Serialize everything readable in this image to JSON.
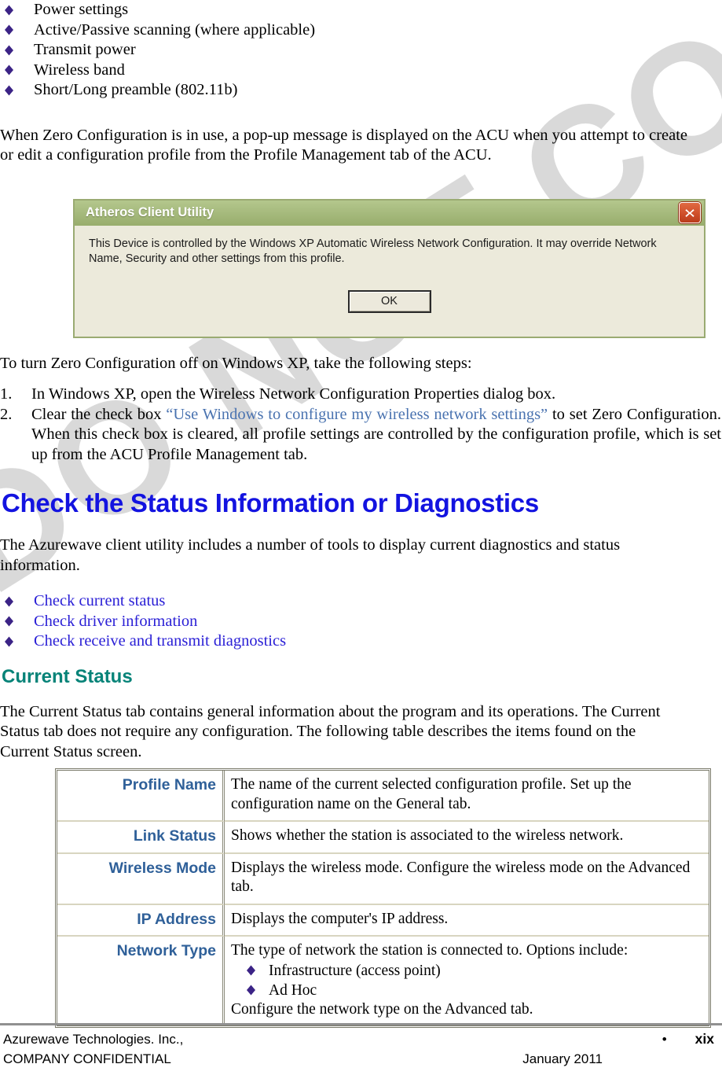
{
  "feature_bullets": [
    {
      "label": "Power settings"
    },
    {
      "label": "Active/Passive scanning (where applicable)"
    },
    {
      "label": "Transmit power"
    },
    {
      "label": "Wireless band"
    },
    {
      "label": "Short/Long preamble (802.11b)"
    }
  ],
  "intro_paragraph": "When Zero Configuration is in use, a pop-up message is displayed on the ACU when you attempt to create or edit a configuration profile from the Profile Management tab of the ACU.",
  "dialog": {
    "title": "Atheros Client Utility",
    "message": "This Device is controlled by the Windows XP Automatic Wireless Network Configuration. It may override Network Name, Security and other settings from this profile.",
    "ok_label": "OK",
    "close_label": "×",
    "titlebar_color": "#a7bb7e",
    "body_color": "#eceadb",
    "close_button_color": "#cf4f2b"
  },
  "steps_intro": "To turn Zero Configuration off on Windows XP, take the following steps:",
  "steps": [
    {
      "number": "1.",
      "text_parts": [
        {
          "text": "In Windows XP, open the Wireless Network Configuration Properties dialog box.",
          "style": "normal"
        }
      ]
    },
    {
      "number": "2.",
      "text_parts": [
        {
          "text": " Clear the check box ",
          "style": "normal"
        },
        {
          "text": "“Use Windows to configure my wireless network settings”",
          "style": "link"
        },
        {
          "text": " to set Zero Configuration.  When this check box is cleared, all profile settings are controlled by the configuration profile, which is set up from the ACU Profile Management tab.",
          "style": "normal"
        }
      ]
    }
  ],
  "main_heading": "Check the Status Information or Diagnostics",
  "main_heading_color": "#1313e0",
  "diagnostics_paragraph": "The Azurewave client utility includes a number of tools to display current diagnostics and status information.",
  "diagnostics_links": [
    {
      "label": "Check current status"
    },
    {
      "label": "Check driver information"
    },
    {
      "label": "Check receive and transmit diagnostics"
    }
  ],
  "sub_heading": "Current Status",
  "sub_heading_color": "#068378",
  "current_status_paragraph": "The Current Status tab contains general information about the program and its operations. The Current Status tab does not require any configuration. The following table describes the items found on the Current Status screen.",
  "status_table": {
    "label_color": "#2f6099",
    "rows": [
      {
        "label": "Profile Name",
        "description": "The name of the current selected configuration profile.  Set up the configuration name on the General tab.",
        "bullets": [],
        "description_after": ""
      },
      {
        "label": "Link Status",
        "description": "Shows whether the station is associated to the wireless network.",
        "bullets": [],
        "description_after": ""
      },
      {
        "label": "Wireless Mode",
        "description": "Displays the wireless mode.  Configure the wireless mode on the Advanced tab.",
        "bullets": [],
        "description_after": ""
      },
      {
        "label": "IP Address",
        "description": "Displays the computer's IP address.",
        "bullets": [],
        "description_after": ""
      },
      {
        "label": "Network Type",
        "description": "The type of network the station is connected to.  Options include:",
        "bullets": [
          {
            "label": "Infrastructure (access point)"
          },
          {
            "label": "Ad Hoc"
          }
        ],
        "description_after": "Configure the network type on the Advanced tab."
      }
    ]
  },
  "watermark": {
    "text": "DO NOT COPY",
    "color": "#d8d8d8"
  },
  "footer": {
    "company": "Azurewave Technologies. Inc.,",
    "confidential": "COMPANY CONFIDENTIAL",
    "separator_dot": "•",
    "page_number": "xix",
    "date": "January 2011"
  }
}
